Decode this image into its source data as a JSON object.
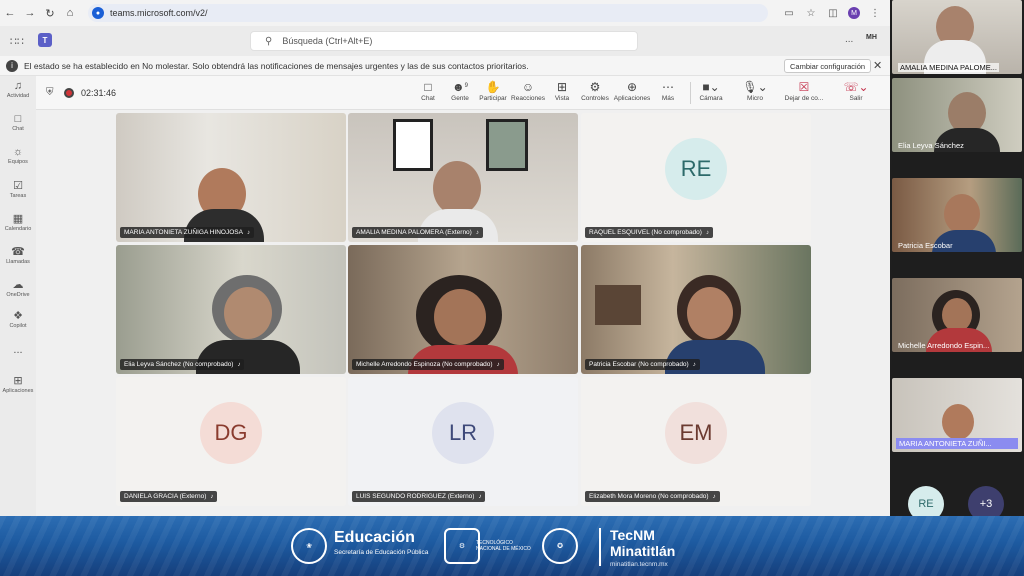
{
  "browser": {
    "url": "teams.microsoft.com/v2/",
    "profile_initial": "M"
  },
  "teams_header": {
    "search_placeholder": "Búsqueda (Ctrl+Alt+E)",
    "user_initials": "MH",
    "more": "..."
  },
  "notification": {
    "text": "El estado se ha establecido en No molestar. Solo obtendrá las notificaciones de mensajes urgentes y las de sus contactos prioritarios.",
    "button": "Cambiar configuración"
  },
  "rail": [
    {
      "label": "Actividad",
      "icon": "bell-icon"
    },
    {
      "label": "Chat",
      "icon": "chat-icon"
    },
    {
      "label": "Equipos",
      "icon": "teams-icon"
    },
    {
      "label": "Tareas",
      "icon": "tasks-icon"
    },
    {
      "label": "Calendario",
      "icon": "calendar-icon"
    },
    {
      "label": "Llamadas",
      "icon": "phone-icon"
    },
    {
      "label": "OneDrive",
      "icon": "cloud-icon"
    },
    {
      "label": "Copilot",
      "icon": "copilot-icon"
    },
    {
      "label": "...",
      "icon": "more-icon"
    },
    {
      "label": "Aplicaciones",
      "icon": "apps-icon"
    }
  ],
  "meeting": {
    "timer": "02:31:46",
    "people_count": "9",
    "toolbar": {
      "chat": "Chat",
      "people": "Gente",
      "raise": "Participar",
      "react": "Reacciones",
      "view": "Vista",
      "controls": "Controles",
      "apps": "Aplicaciones",
      "more": "Más",
      "camera": "Cámara",
      "mic": "Micro",
      "share": "Dejar de co...",
      "leave": "Salir"
    }
  },
  "tiles": [
    {
      "name": "MARIA ANTONIETA ZUÑIGA HINOJOSA",
      "type": "video"
    },
    {
      "name": "AMALIA MEDINA PALOMERA (Externo)",
      "type": "video"
    },
    {
      "name": "RAQUEL ESQUIVEL (No comprobado)",
      "type": "avatar",
      "initials": "RE"
    },
    {
      "name": "Elia Leyva Sánchez (No comprobado)",
      "type": "video"
    },
    {
      "name": "Michelle Arredondo Espinoza (No comprobado)",
      "type": "video"
    },
    {
      "name": "Patricia Escobar (No comprobado)",
      "type": "video"
    },
    {
      "name": "DANIELA GRACIA (Externo)",
      "type": "avatar",
      "initials": "DG"
    },
    {
      "name": "LUIS SEGUNDO RODRIGUEZ (Externo)",
      "type": "avatar",
      "initials": "LR"
    },
    {
      "name": "Elizabeth Mora Moreno (No comprobado)",
      "type": "avatar",
      "initials": "EM"
    }
  ],
  "side_tiles": [
    {
      "name": "AMALIA MEDINA PALOME..."
    },
    {
      "name": "Elia Leyva Sánchez"
    },
    {
      "name": "Patricia Escobar"
    },
    {
      "name": "Michelle Arredondo Espin..."
    },
    {
      "name": "MARIA ANTONIETA ZUÑI..."
    }
  ],
  "side_bubbles": {
    "re": "RE",
    "more": "+3"
  },
  "banner": {
    "edu_title": "Educación",
    "edu_sub": "Secretaría de Educación Pública",
    "tec_text": "TECNOLÓGICO NACIONAL DE MÉXICO",
    "tecnm": "TecNM",
    "minatitlan": "Minatitlán",
    "domain": "minatitlan.tecnm.mx"
  },
  "colors": {
    "accent": "#5b5fc7",
    "leave": "#c4314b",
    "banner": "#1d5aa0"
  }
}
